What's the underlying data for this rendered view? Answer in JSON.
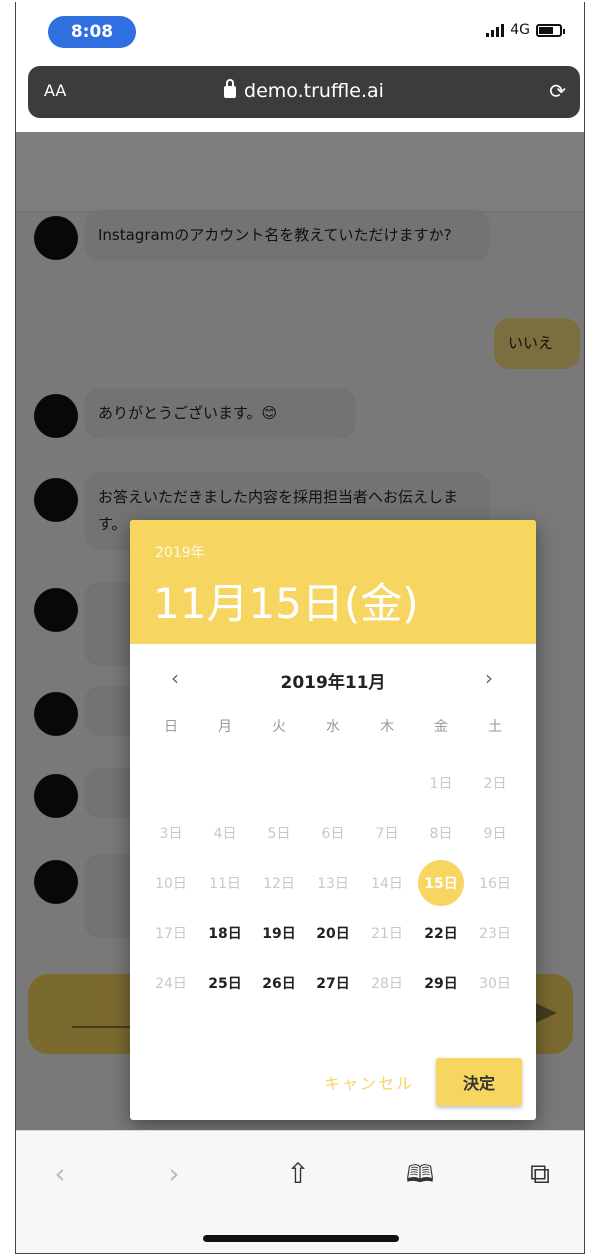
{
  "status_bar": {
    "time": "8:08",
    "network": "4G"
  },
  "browser": {
    "text_size_label": "AA",
    "url": "demo.truffle.ai",
    "reload_icon": "reload-icon"
  },
  "chat": {
    "messages": [
      {
        "from": "bot",
        "text": "Instagramのアカウント名を教えていただけますか?"
      },
      {
        "from": "user",
        "text": "いいえ"
      },
      {
        "from": "bot",
        "text": "ありがとうございます。😊"
      },
      {
        "from": "bot",
        "text": "お答えいただきました内容を採用担当者へお伝えします。"
      }
    ]
  },
  "date_picker": {
    "year": "2019年",
    "selected_date": "11月15日(金)",
    "month_title": "2019年11月",
    "prev_icon": "‹",
    "next_icon": "›",
    "weekdays": [
      "日",
      "月",
      "火",
      "水",
      "木",
      "金",
      "土"
    ],
    "days": [
      {
        "label": "",
        "state": "empty"
      },
      {
        "label": "",
        "state": "empty"
      },
      {
        "label": "",
        "state": "empty"
      },
      {
        "label": "",
        "state": "empty"
      },
      {
        "label": "",
        "state": "empty"
      },
      {
        "label": "1日",
        "state": "disabled"
      },
      {
        "label": "2日",
        "state": "disabled"
      },
      {
        "label": "3日",
        "state": "disabled"
      },
      {
        "label": "4日",
        "state": "disabled"
      },
      {
        "label": "5日",
        "state": "disabled"
      },
      {
        "label": "6日",
        "state": "disabled"
      },
      {
        "label": "7日",
        "state": "disabled"
      },
      {
        "label": "8日",
        "state": "disabled"
      },
      {
        "label": "9日",
        "state": "disabled"
      },
      {
        "label": "10日",
        "state": "disabled"
      },
      {
        "label": "11日",
        "state": "disabled"
      },
      {
        "label": "12日",
        "state": "disabled"
      },
      {
        "label": "13日",
        "state": "disabled"
      },
      {
        "label": "14日",
        "state": "disabled"
      },
      {
        "label": "15日",
        "state": "selected"
      },
      {
        "label": "16日",
        "state": "disabled"
      },
      {
        "label": "17日",
        "state": "disabled"
      },
      {
        "label": "18日",
        "state": "enabled"
      },
      {
        "label": "19日",
        "state": "enabled"
      },
      {
        "label": "20日",
        "state": "enabled"
      },
      {
        "label": "21日",
        "state": "disabled"
      },
      {
        "label": "22日",
        "state": "enabled"
      },
      {
        "label": "23日",
        "state": "disabled"
      },
      {
        "label": "24日",
        "state": "disabled"
      },
      {
        "label": "25日",
        "state": "enabled"
      },
      {
        "label": "26日",
        "state": "enabled"
      },
      {
        "label": "27日",
        "state": "enabled"
      },
      {
        "label": "28日",
        "state": "disabled"
      },
      {
        "label": "29日",
        "state": "enabled"
      },
      {
        "label": "30日",
        "state": "disabled"
      }
    ],
    "cancel_label": "キャンセル",
    "ok_label": "決定",
    "accent_color": "#f7d561"
  },
  "toolbar": {
    "back": "‹",
    "forward": "›",
    "share": "⇧",
    "bookmarks": "📖",
    "tabs": "⧉"
  }
}
